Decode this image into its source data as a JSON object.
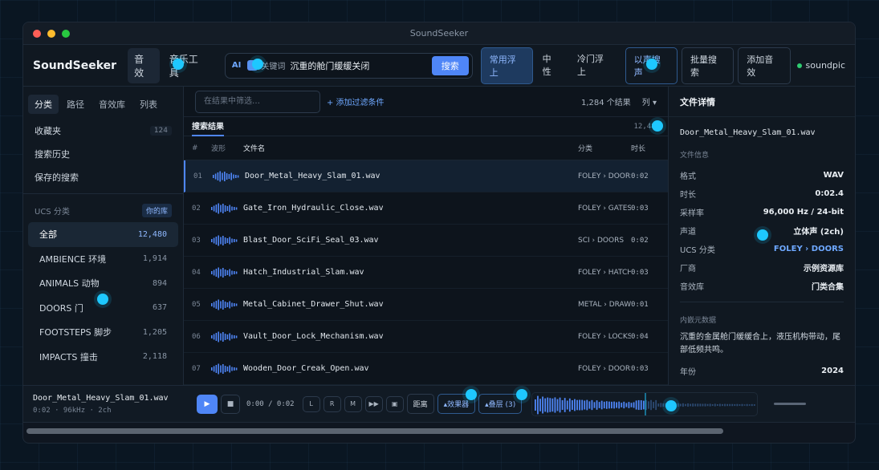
{
  "app": {
    "title": "SoundSeeker"
  },
  "toolbar": {
    "brand": "SoundSeeker",
    "nav": [
      "音效",
      "音乐工具"
    ],
    "ai_label": "AI",
    "keyword_label": "关键词",
    "search_value": "沉重的舱门缓缓关闭",
    "search_button": "搜索",
    "rank_options": [
      "常用浮上",
      "中性",
      "冷门浮上"
    ],
    "similar_button": "以声搜声",
    "batch_button": "批量搜索",
    "add_button": "添加音效",
    "status_label": "soundpic"
  },
  "sidebar": {
    "tabs": [
      "分类",
      "路径",
      "音效库",
      "列表"
    ],
    "links": [
      {
        "label": "收藏夹",
        "count": "124"
      },
      {
        "label": "搜索历史",
        "count": ""
      },
      {
        "label": "保存的搜索",
        "count": ""
      }
    ],
    "ucs_heading": "UCS 分类",
    "ucs_badge": "你的库",
    "categories": [
      {
        "label": "全部",
        "count": "12,480"
      },
      {
        "label": "AMBIENCE 环境",
        "count": "1,914"
      },
      {
        "label": "ANIMALS 动物",
        "count": "894"
      },
      {
        "label": "DOORS 门",
        "count": "637"
      },
      {
        "label": "FOOTSTEPS 脚步",
        "count": "1,205"
      },
      {
        "label": "IMPACTS 撞击",
        "count": "2,118"
      }
    ]
  },
  "results": {
    "filter_placeholder": "在结果中筛选…",
    "add_filter": "+ 添加过滤条件",
    "result_count": "1,284 个结果",
    "columns_label": "列",
    "tab_label": "搜索结果",
    "total": "12,480",
    "headers": {
      "num": "#",
      "wave": "波形",
      "name": "文件名",
      "cat": "分类",
      "dur": "时长"
    },
    "rows": [
      {
        "num": "01",
        "name": "Door_Metal_Heavy_Slam_01.wav",
        "cat": "FOLEY › DOORS",
        "dur": "0:02"
      },
      {
        "num": "02",
        "name": "Gate_Iron_Hydraulic_Close.wav",
        "cat": "FOLEY › GATES",
        "dur": "0:03"
      },
      {
        "num": "03",
        "name": "Blast_Door_SciFi_Seal_03.wav",
        "cat": "SCI › DOORS",
        "dur": "0:02"
      },
      {
        "num": "04",
        "name": "Hatch_Industrial_Slam.wav",
        "cat": "FOLEY › HATCH",
        "dur": "0:03"
      },
      {
        "num": "05",
        "name": "Metal_Cabinet_Drawer_Shut.wav",
        "cat": "METAL › DRAWER",
        "dur": "0:01"
      },
      {
        "num": "06",
        "name": "Vault_Door_Lock_Mechanism.wav",
        "cat": "FOLEY › LOCKS",
        "dur": "0:04"
      },
      {
        "num": "07",
        "name": "Wooden_Door_Creak_Open.wav",
        "cat": "FOLEY › DOORS",
        "dur": "0:03"
      }
    ]
  },
  "details": {
    "heading": "文件详情",
    "filename": "Door_Metal_Heavy_Slam_01.wav",
    "info_heading": "文件信息",
    "info": [
      {
        "k": "格式",
        "v": "WAV"
      },
      {
        "k": "时长",
        "v": "0:02.4"
      },
      {
        "k": "采样率",
        "v": "96,000 Hz / 24-bit"
      },
      {
        "k": "声道",
        "v": "立体声 (2ch)"
      },
      {
        "k": "UCS 分类",
        "v": "FOLEY › DOORS"
      },
      {
        "k": "厂商",
        "v": "示例资源库"
      },
      {
        "k": "音效库",
        "v": "门类合集"
      }
    ],
    "meta_heading": "内嵌元数据",
    "description": "沉重的金属舱门缓缓合上，液压机构带动，尾部低频共鸣。",
    "year_label": "年份",
    "year": "2024"
  },
  "player": {
    "title": "Door_Metal_Heavy_Slam_01.wav",
    "sub": "0:02 · 96kHz · 2ch",
    "time": "0:00 / 0:02",
    "buttons": [
      "L",
      "R",
      "M",
      "▶▶",
      "▣"
    ],
    "distance": "距离",
    "effects": "▴效果器",
    "layers": "▴叠层 (3)",
    "progress": 0.5
  },
  "colors": {
    "accent": "#4f86f7",
    "ok": "#2fcc71",
    "touch": "#1ec8ff"
  }
}
